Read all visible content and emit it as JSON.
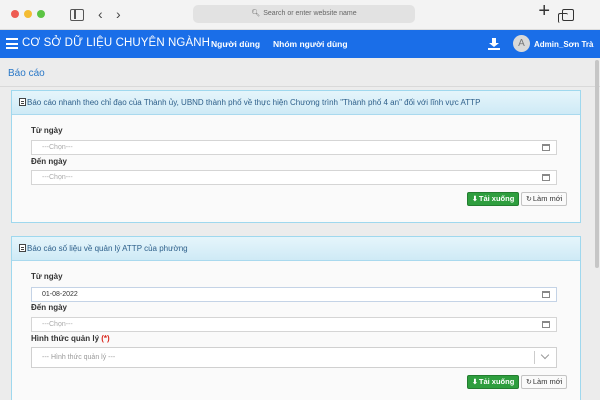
{
  "browser": {
    "address_placeholder": "Search or enter website name"
  },
  "header": {
    "title": "CƠ SỞ DỮ LIỆU CHUYÊN NGÀNH",
    "nav": [
      "Người dùng",
      "Nhóm người dùng"
    ],
    "avatar_letter": "A",
    "user_name": "Admin_Sơn Trà",
    "bg_color": "#1a6ee8"
  },
  "page": {
    "title": "Báo cáo"
  },
  "panel1": {
    "title": "Báo cáo nhanh theo chỉ đạo của Thành ủy, UBND thành phố về thực hiện Chương trình \"Thành phố 4 an\" đối với lĩnh vực ATTP",
    "from_label": "Từ ngày",
    "from_value": "---Chọn---",
    "to_label": "Đến ngày",
    "to_value": "---Chọn---",
    "download_label": "Tải xuống",
    "reset_label": "Làm mới"
  },
  "panel2": {
    "title": "Báo cáo số liệu về quản lý ATTP của phường",
    "from_label": "Từ ngày",
    "from_value": "01-08-2022",
    "to_label": "Đến ngày",
    "to_value": "---Chọn---",
    "mgmt_label": "Hình thức quản lý",
    "mgmt_required": "(*)",
    "mgmt_placeholder": "--- Hình thức quản lý ---",
    "download_label": "Tải xuống",
    "reset_label": "Làm mới"
  }
}
